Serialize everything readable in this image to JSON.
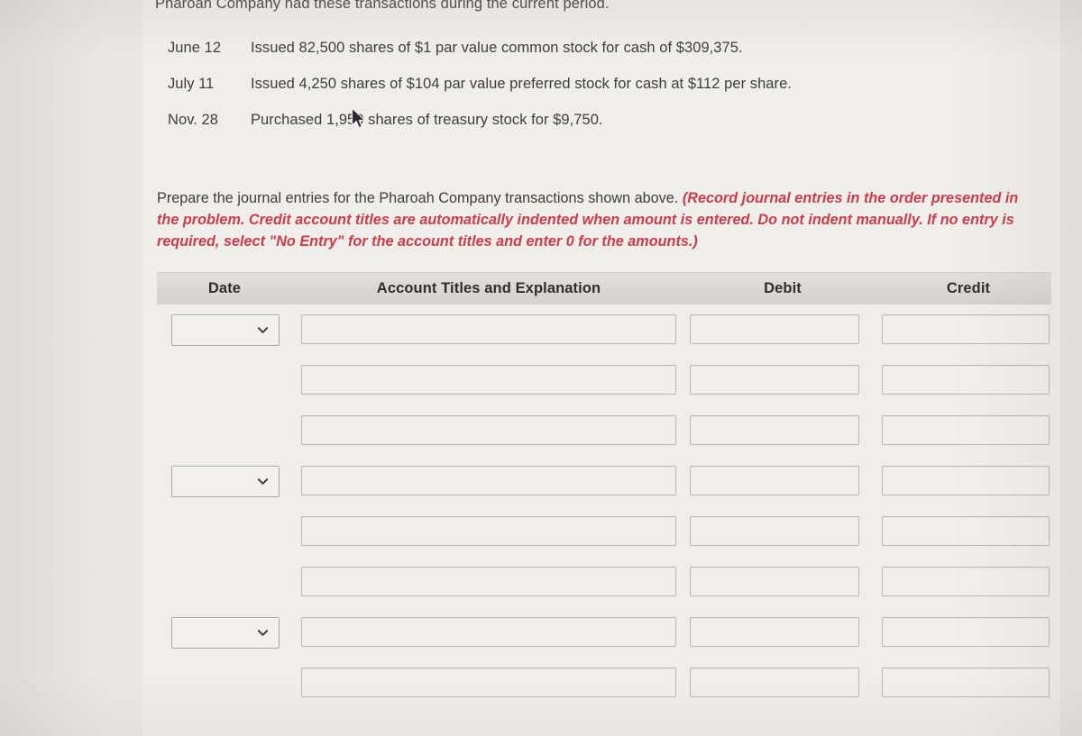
{
  "page": {
    "intro": "Pharoah Company had these transactions during the current period.",
    "background_color": "#efeeea",
    "accent_red": "#cf3b4b"
  },
  "transactions": [
    {
      "date": "June 12",
      "description": "Issued 82,500 shares of $1 par value common stock for cash of $309,375."
    },
    {
      "date": "July 11",
      "description": "Issued 4,250 shares of $104 par value preferred stock for cash at $112 per share."
    },
    {
      "date": "Nov. 28",
      "description": "Purchased 1,950 shares of treasury stock for $9,750."
    }
  ],
  "instructions": {
    "plain": "Prepare the journal entries for the Pharoah Company transactions shown above. ",
    "emphasis": "(Record journal entries in the order presented in the problem. Credit account titles are automatically indented when amount is entered. Do not indent manually. If no entry is required, select \"No Entry\" for the account titles and enter 0 for the amounts.)"
  },
  "journal": {
    "columns": {
      "date": "Date",
      "titles": "Account Titles and Explanation",
      "debit": "Debit",
      "credit": "Credit"
    },
    "rows": [
      {
        "date_value": "",
        "date_placeholder": "",
        "has_date": true,
        "account": "",
        "debit": "",
        "credit": ""
      },
      {
        "date_value": "",
        "date_placeholder": "",
        "has_date": false,
        "account": "",
        "debit": "",
        "credit": ""
      },
      {
        "date_value": "",
        "date_placeholder": "",
        "has_date": false,
        "account": "",
        "debit": "",
        "credit": ""
      },
      {
        "date_value": "",
        "date_placeholder": "",
        "has_date": true,
        "account": "",
        "debit": "",
        "credit": ""
      },
      {
        "date_value": "",
        "date_placeholder": "",
        "has_date": false,
        "account": "",
        "debit": "",
        "credit": ""
      },
      {
        "date_value": "",
        "date_placeholder": "",
        "has_date": false,
        "account": "",
        "debit": "",
        "credit": ""
      },
      {
        "date_value": "",
        "date_placeholder": "",
        "has_date": true,
        "account": "",
        "debit": "",
        "credit": ""
      },
      {
        "date_value": "",
        "date_placeholder": "",
        "has_date": false,
        "account": "",
        "debit": "",
        "credit": ""
      }
    ]
  },
  "icons": {
    "dropdown": "chevron-down-icon",
    "pointer": "mouse-pointer-icon"
  }
}
